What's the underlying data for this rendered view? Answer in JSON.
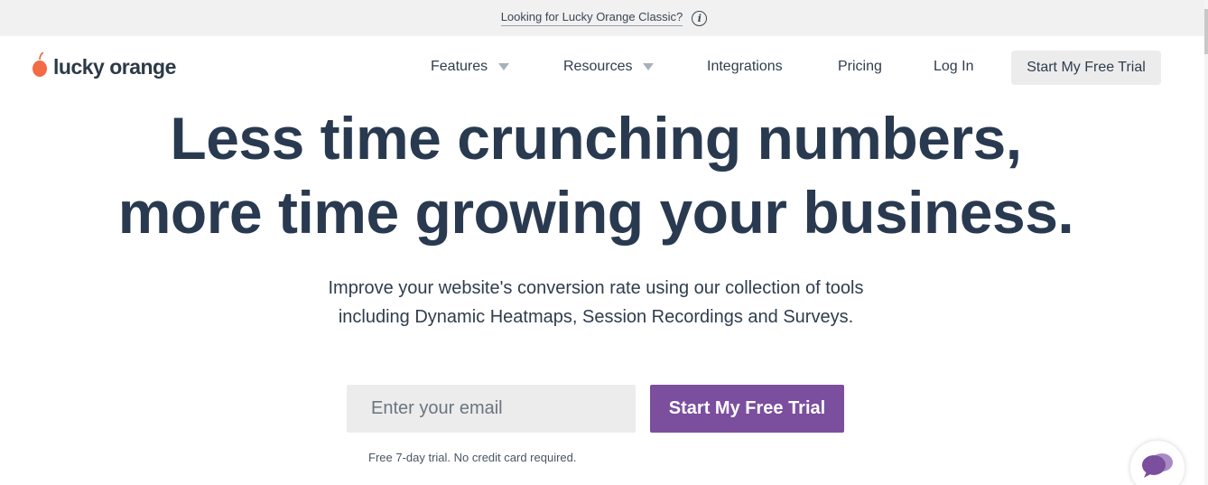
{
  "announcement": {
    "link_text": "Looking for Lucky Orange Classic?",
    "info_icon": "info-icon"
  },
  "nav": {
    "logo_text": "lucky orange",
    "logo_icon": "orange-fruit-icon",
    "items": [
      {
        "label": "Features",
        "has_dropdown": true
      },
      {
        "label": "Resources",
        "has_dropdown": true
      },
      {
        "label": "Integrations",
        "has_dropdown": false
      },
      {
        "label": "Pricing",
        "has_dropdown": false
      },
      {
        "label": "Log In",
        "has_dropdown": false
      }
    ],
    "cta_label": "Start My Free Trial"
  },
  "hero": {
    "headline_line1": "Less time crunching numbers,",
    "headline_line2": "more time growing your business.",
    "subhead_line1": "Improve your website's conversion rate using our collection of tools",
    "subhead_line2": "including Dynamic Heatmaps, Session Recordings and Surveys.",
    "email_placeholder": "Enter your email",
    "email_value": "",
    "cta_label": "Start My Free Trial",
    "disclaimer": "Free 7-day trial. No credit card required."
  },
  "chat_widget": {
    "icon": "chat-bubbles-icon"
  },
  "colors": {
    "brand_orange": "#f26b45",
    "brand_purple": "#7b4e9e",
    "text_dark": "#293a50",
    "announce_bg": "#f1f1f1"
  }
}
